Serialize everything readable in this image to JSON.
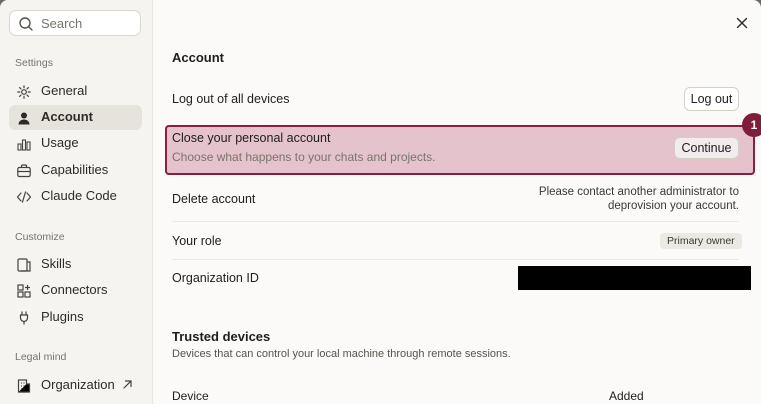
{
  "sidebar": {
    "search_placeholder": "Search",
    "sections": {
      "settings": "Settings",
      "customize": "Customize",
      "legal": "Legal mind"
    },
    "items": [
      {
        "label": "General"
      },
      {
        "label": "Account"
      },
      {
        "label": "Usage"
      },
      {
        "label": "Capabilities"
      },
      {
        "label": "Claude Code"
      },
      {
        "label": "Skills"
      },
      {
        "label": "Connectors"
      },
      {
        "label": "Plugins"
      },
      {
        "label": "Organization"
      }
    ]
  },
  "account": {
    "title": "Account",
    "logout_all": {
      "label": "Log out of all devices",
      "button": "Log out"
    },
    "close_account": {
      "label": "Close your personal account",
      "description": "Choose what happens to your chats and projects.",
      "button": "Continue"
    },
    "delete_account": {
      "label": "Delete account",
      "note_line1": "Please contact another administrator to",
      "note_line2": "deprovision your account."
    },
    "role": {
      "label": "Your role",
      "value": "Primary owner"
    },
    "org_id": {
      "label": "Organization ID"
    }
  },
  "trusted": {
    "title": "Trusted devices",
    "description": "Devices that can control your local machine through remote sessions.",
    "col_device": "Device",
    "col_added": "Added"
  },
  "annotation": {
    "marker": "1"
  }
}
